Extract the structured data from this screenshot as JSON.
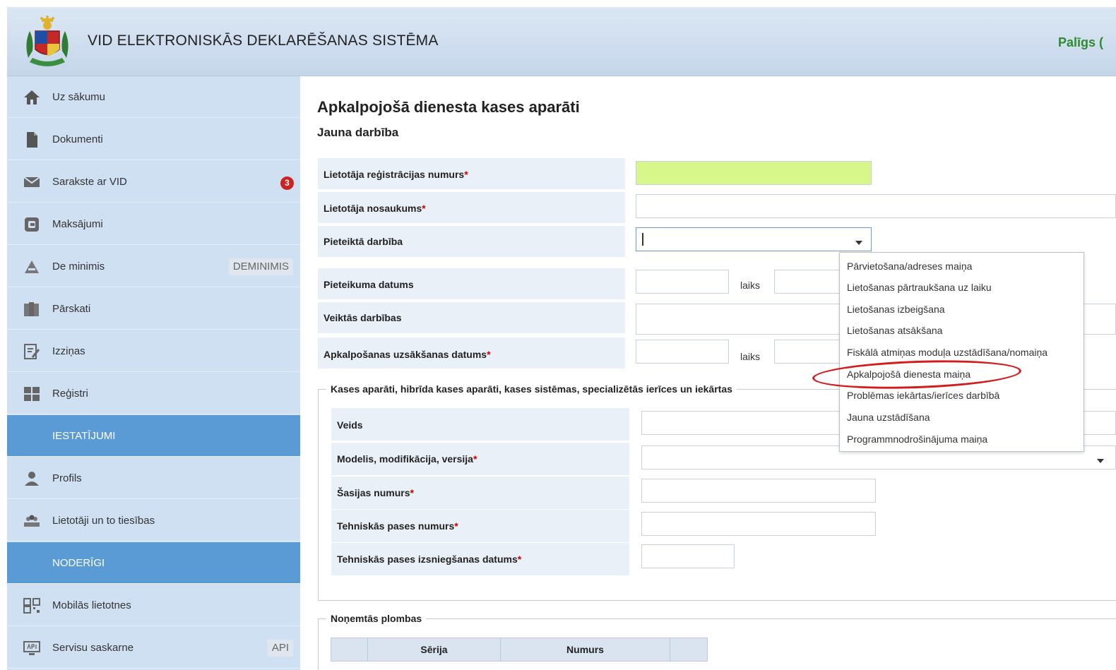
{
  "header": {
    "title": "VID ELEKTRONISKĀS DEKLARĒŠANAS SISTĒMA",
    "help_link": "Palīgs ("
  },
  "sidebar": {
    "items": [
      {
        "label": "Uz sākumu",
        "icon": "home-icon"
      },
      {
        "label": "Dokumenti",
        "icon": "document-icon"
      },
      {
        "label": "Sarakste ar VID",
        "icon": "envelope-icon",
        "badge": "3"
      },
      {
        "label": "Maksājumi",
        "icon": "payment-icon"
      },
      {
        "label": "De minimis",
        "icon": "scales-icon",
        "tag": "DEMINIMIS"
      },
      {
        "label": "Pārskati",
        "icon": "reports-icon"
      },
      {
        "label": "Izziņas",
        "icon": "certificate-icon"
      },
      {
        "label": "Reģistri",
        "icon": "grid-icon"
      },
      {
        "label": "Profils",
        "icon": "user-icon"
      },
      {
        "label": "Lietotāji un to tiesības",
        "icon": "users-icon"
      },
      {
        "label": "Mobilās lietotnes",
        "icon": "qr-icon"
      },
      {
        "label": "Servisu saskarne",
        "icon": "api-icon",
        "tag": "API"
      }
    ],
    "sections": {
      "settings": "IESTATĪJUMI",
      "useful": "NODERĪGI"
    }
  },
  "main": {
    "title": "Apkalpojošā dienesta kases aparāti",
    "subtitle": "Jauna darbība",
    "fields": {
      "reg_number": "Lietotāja reģistrācijas numurs",
      "user_name": "Lietotāja nosaukums",
      "action": "Pieteiktā darbība",
      "application_date": "Pieteikuma datums",
      "performed_actions": "Veiktās darbības",
      "service_start_date": "Apkalpošanas uzsākšanas datums",
      "time_label": "laiks"
    },
    "required_mark": "*",
    "devices_section": {
      "legend": "Kases aparāti, hibrīda kases aparāti, kases sistēmas, specializētās ierīces un iekārtas",
      "type": "Veids",
      "model": "Modelis, modifikācija, versija",
      "chassis": "Šasijas numurs",
      "passport_number": "Tehniskās pases numurs",
      "passport_date": "Tehniskās pases izsniegšanas datums"
    },
    "seals_section": {
      "legend": "Noņemtās plombas",
      "columns": [
        "Sērija",
        "Numurs"
      ]
    }
  },
  "dropdown": {
    "options": [
      "Pārvietošana/adreses maiņa",
      "Lietošanas pārtraukšana uz laiku",
      "Lietošanas izbeigšana",
      "Lietošanas atsākšana",
      "Fiskālā atmiņas moduļa uzstādīšana/nomaiņa",
      "Apkalpojošā dienesta maiņa",
      "Problēmas iekārtas/ierīces darbībā",
      "Jauna uzstādīšana",
      "Programmnodrošinājuma maiņa"
    ],
    "highlighted_color": "#d41c1c"
  },
  "colors": {
    "sidebar_bg": "#cfe0f3",
    "section_bg": "#5b9bd5",
    "highlight_input": "#d8f78b",
    "help_green": "#2e8b2e",
    "badge_red": "#cc2222"
  }
}
